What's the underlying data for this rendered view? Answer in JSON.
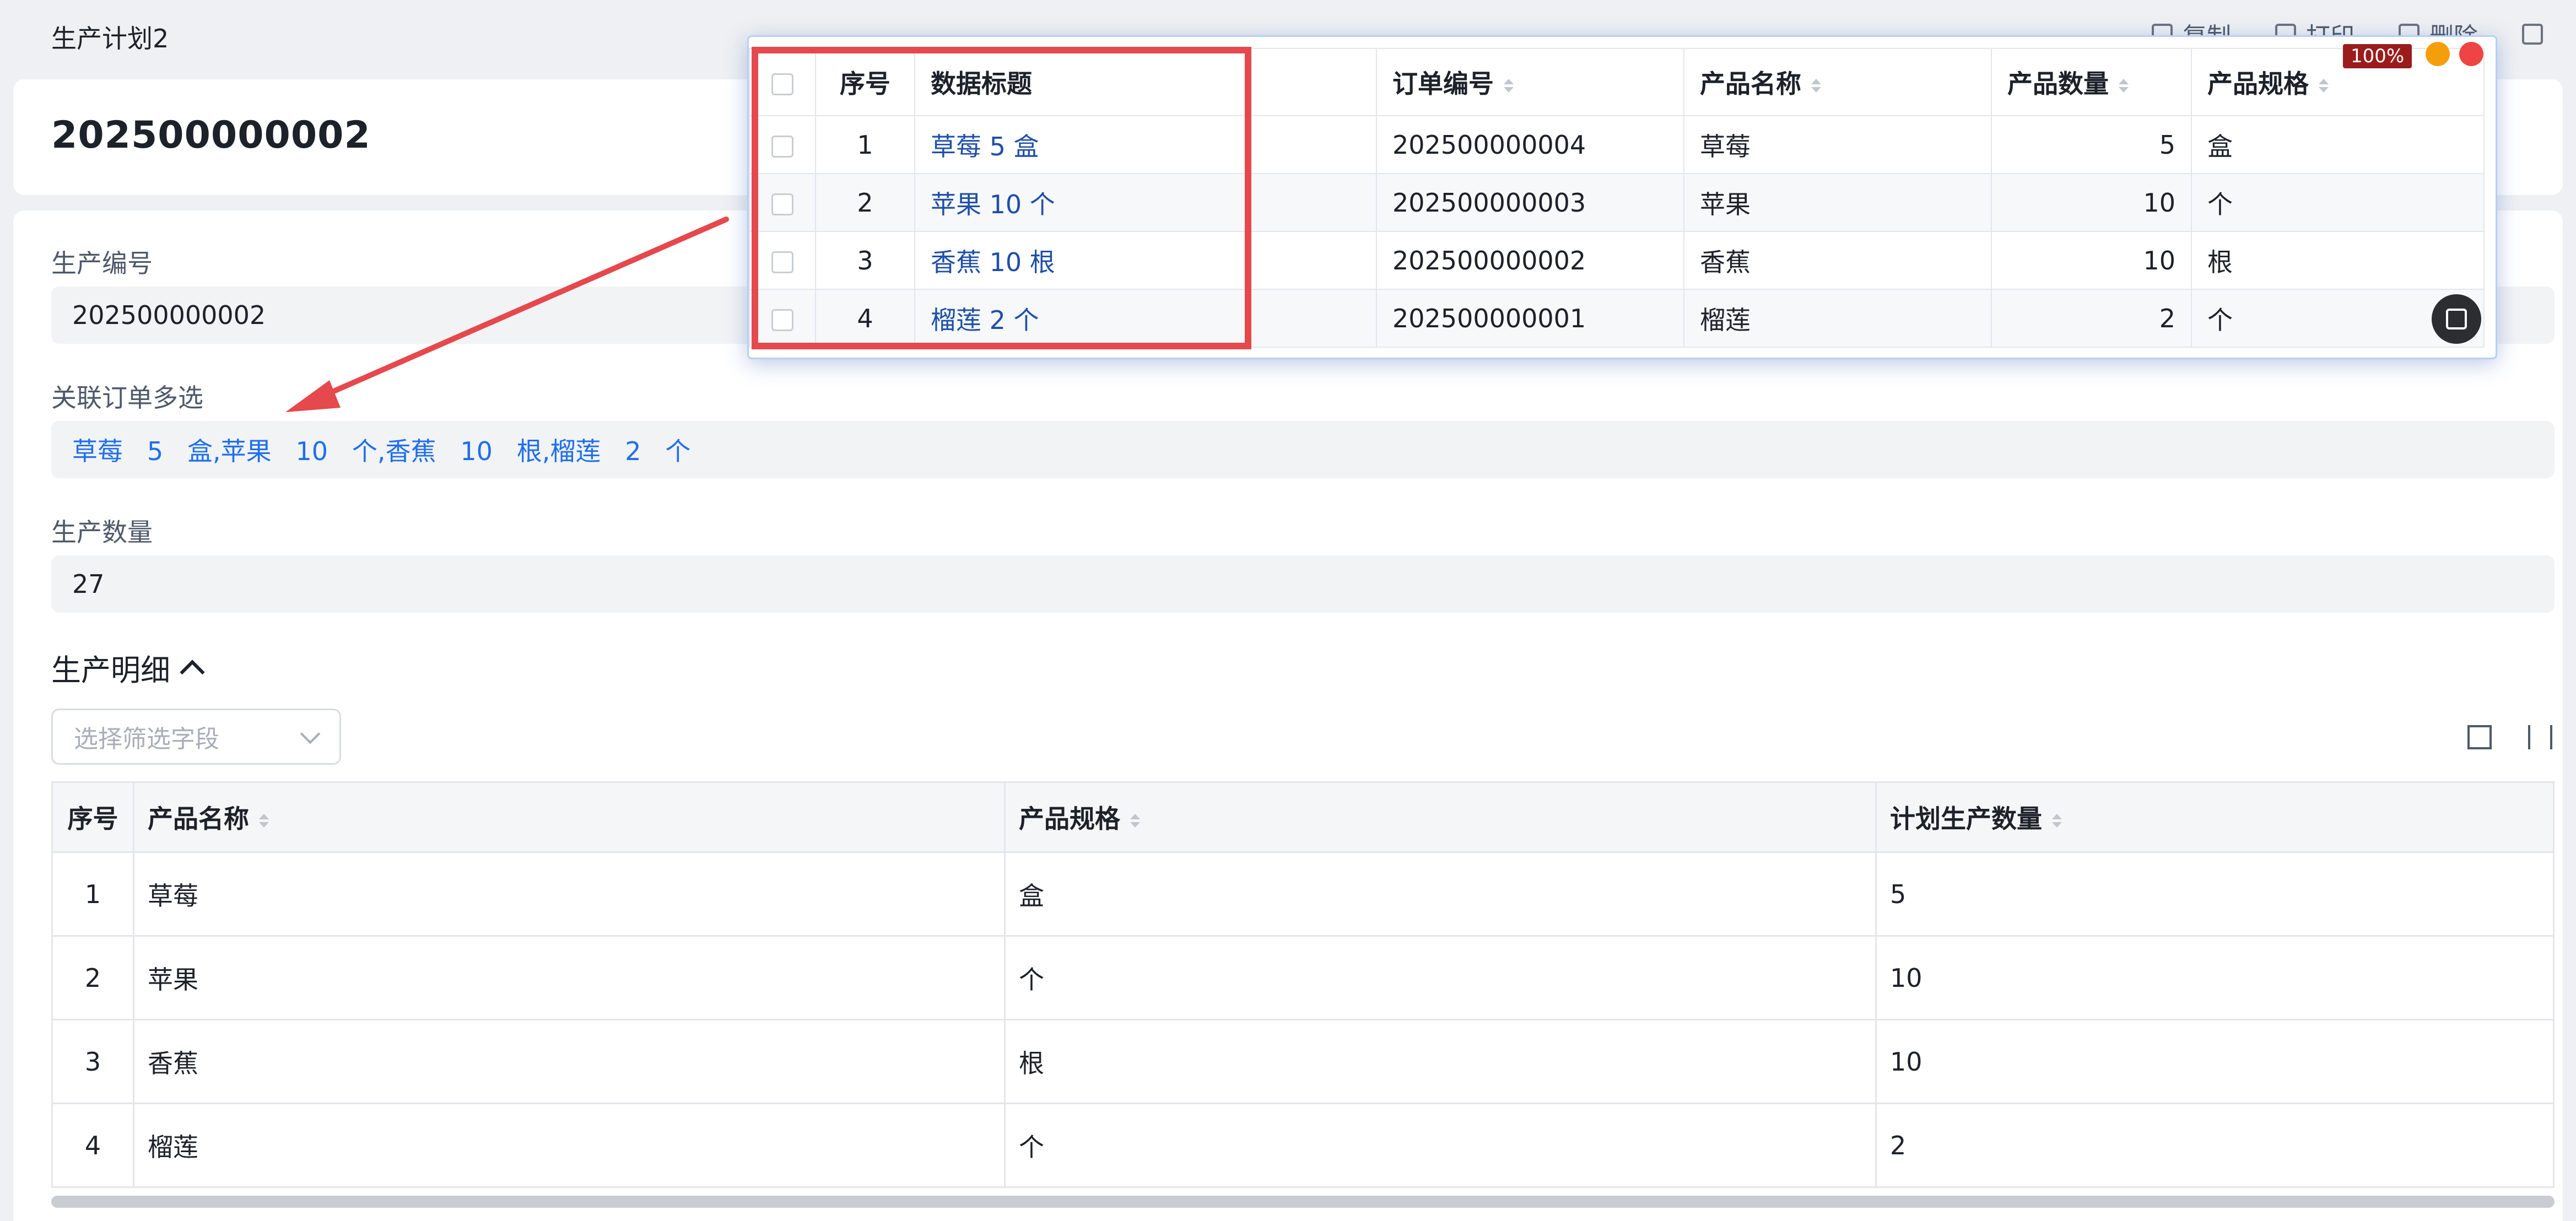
{
  "header": {
    "title": "生产计划2",
    "actions": [
      "复制",
      "打印",
      "删除"
    ]
  },
  "record": {
    "number": "202500000002"
  },
  "fields": {
    "production_no": {
      "label": "生产编号",
      "value": "202500000002"
    },
    "related_orders": {
      "label": "关联订单多选",
      "value": "草莓   5   盒,苹果   10   个,香蕉   10   根,榴莲   2   个"
    },
    "production_qty": {
      "label": "生产数量",
      "value": "27"
    }
  },
  "detail": {
    "title": "生产明细",
    "filter_placeholder": "选择筛选字段",
    "columns": [
      "序号",
      "产品名称",
      "产品规格",
      "计划生产数量"
    ],
    "rows": [
      [
        "1",
        "草莓",
        "盒",
        "5"
      ],
      [
        "2",
        "苹果",
        "个",
        "10"
      ],
      [
        "3",
        "香蕉",
        "根",
        "10"
      ],
      [
        "4",
        "榴莲",
        "个",
        "2"
      ]
    ]
  },
  "popup": {
    "zoom": "100%",
    "columns": [
      "序号",
      "数据标题",
      "订单编号",
      "产品名称",
      "产品数量",
      "产品规格"
    ],
    "rows": [
      [
        "1",
        "草莓 5 盒",
        "202500000004",
        "草莓",
        "5",
        "盒"
      ],
      [
        "2",
        "苹果 10 个",
        "202500000003",
        "苹果",
        "10",
        "个"
      ],
      [
        "3",
        "香蕉 10 根",
        "202500000002",
        "香蕉",
        "10",
        "根"
      ],
      [
        "4",
        "榴莲 2 个",
        "202500000001",
        "榴莲",
        "2",
        "个"
      ]
    ]
  },
  "colors": {
    "link": "#1f6feb",
    "highlight": "#e5484d"
  }
}
